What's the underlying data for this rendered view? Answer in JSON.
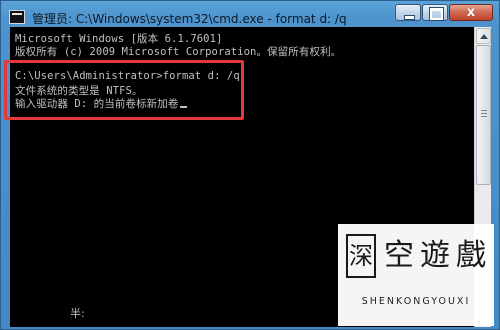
{
  "window": {
    "title": "管理员: C:\\Windows\\system32\\cmd.exe - format  d: /q",
    "close_glyph": "x"
  },
  "console": {
    "lines": [
      "Microsoft Windows [版本 6.1.7601]",
      "版权所有 (c) 2009 Microsoft Corporation。保留所有权利。",
      "",
      "C:\\Users\\Administrator>format d: /q",
      "文件系统的类型是 NTFS。",
      "输入驱动器 D: 的当前卷标新加卷"
    ],
    "ime_status": "半:"
  },
  "watermark": {
    "chars": [
      "深",
      "空",
      "遊",
      "戲"
    ],
    "latin": "SHENKONGYOUXI"
  },
  "colors": {
    "console_bg": "#000000",
    "console_text": "#c0c0c0",
    "highlight": "#e23a3a"
  }
}
